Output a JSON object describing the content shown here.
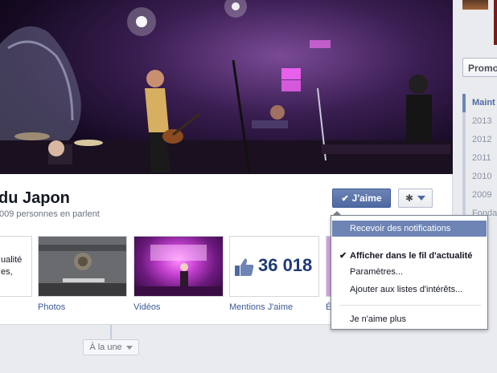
{
  "page": {
    "title": "du Japon",
    "talking_about": "009 personnes en parlent"
  },
  "actions": {
    "like_label": "J'aime",
    "gear_icon": "gear-icon"
  },
  "tiles": {
    "about_lines": [
      "ualité",
      "es,"
    ],
    "photos_label": "Photos",
    "videos_label": "Vidéos",
    "likes_label": "Mentions J'aime",
    "likes_count": "36 018",
    "events_label": "Év"
  },
  "timeline": {
    "a_la_une": "À la une"
  },
  "sidebar": {
    "promo_label": "Promo",
    "years": [
      "Maint",
      "2013",
      "2012",
      "2011",
      "2010",
      "2009",
      "Fonda"
    ]
  },
  "menu": {
    "items": [
      "Recevoir des notifications",
      "Afficher dans le fil d'actualité",
      "Paramètres...",
      "Ajouter aux listes d'intérêts...",
      "Je n'aime plus"
    ]
  },
  "colors": {
    "brand": "#3b5998",
    "like_button": "#4e69a2",
    "highlight": "#6d84b4"
  }
}
